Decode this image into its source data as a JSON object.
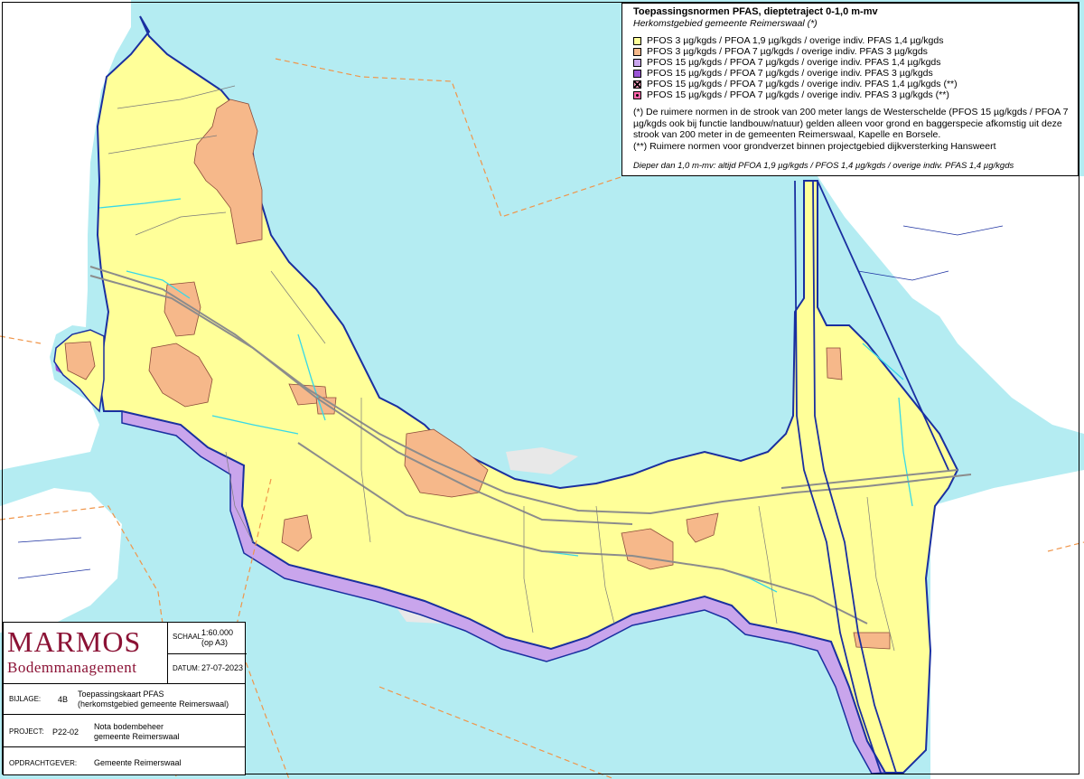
{
  "legend": {
    "title": "Toepassingsnormen PFAS, dieptetraject 0-1,0 m-mv",
    "subtitle": "Herkomstgebied gemeente Reimerswaal (*)",
    "items": [
      {
        "label": "PFOS 3 µg/kgds / PFOA 1,9 µg/kgds / overige indiv. PFAS 1,4 µg/kgds",
        "color": "#ffff99",
        "pattern": "solid"
      },
      {
        "label": "PFOS 3 µg/kgds / PFOA 7 µg/kgds / overige indiv. PFAS 3 µg/kgds",
        "color": "#f6b88a",
        "pattern": "solid"
      },
      {
        "label": "PFOS 15 µg/kgds / PFOA 7 µg/kgds / overige indiv. PFAS 1,4 µg/kgds",
        "color": "#c9a5ec",
        "pattern": "solid"
      },
      {
        "label": "PFOS 15 µg/kgds / PFOA 7 µg/kgds / overige indiv. PFAS 3 µg/kgds",
        "color": "#9b55d6",
        "pattern": "solid"
      },
      {
        "label": "PFOS 15 µg/kgds / PFOA 7 µg/kgds / overige indiv. PFAS 1,4 µg/kgds (**)",
        "color": "#ff9fc0",
        "pattern": "hatch"
      },
      {
        "label": "PFOS 15 µg/kgds / PFOA 7 µg/kgds / overige indiv. PFAS 3 µg/kgds (**)",
        "color": "#ff66aa",
        "pattern": "dots"
      }
    ],
    "note1": "(*) De ruimere normen in de strook van 200 meter langs de Westerschelde (PFOS 15 µg/kgds / PFOA 7 µg/kgds ook bij functie landbouw/natuur) gelden alleen voor grond en baggerspecie afkomstig uit deze strook van 200 meter in de gemeenten Reimerswaal, Kapelle en Borsele.",
    "note2": "(**) Ruimere normen voor grondverzet binnen projectgebied dijkversterking Hansweert",
    "deeper": "Dieper dan 1,0 m-mv: altijd PFOA 1,9 µg/kgds / PFOS 1,4 µg/kgds / overige indiv. PFAS 1,4 µg/kgds"
  },
  "titleblock": {
    "logo_line1": "MARMOS",
    "logo_line2": "Bodemmanagement",
    "scale_label": "SCHAAL:",
    "scale_value": "1:60.000",
    "scale_note": "(op A3)",
    "date_label": "DATUM:",
    "date_value": "27-07-2023",
    "bijlage_label": "BIJLAGE:",
    "bijlage_value": "4B",
    "bijlage_text1": "Toepassingskaart PFAS",
    "bijlage_text2": "(herkomstgebied gemeente Reimerswaal)",
    "project_label": "PROJECT:",
    "project_value": "P22-02",
    "project_text1": "Nota bodembeheer",
    "project_text2": "gemeente Reimerswaal",
    "opdracht_label": "OPDRACHTGEVER:",
    "opdracht_value": "Gemeente Reimerswaal"
  },
  "colors": {
    "water": "#b4ecf2",
    "land_outside": "#ffffff",
    "land_main": "#ffff99",
    "urban": "#f6b88a",
    "dike_strip": "#c9a5ec",
    "dike_strip_dark": "#9b55d6",
    "roads": "#8c8c8c",
    "boundary": "#1a2fa0",
    "canals": "#36d8e8",
    "dashed_border": "#f0954a"
  }
}
